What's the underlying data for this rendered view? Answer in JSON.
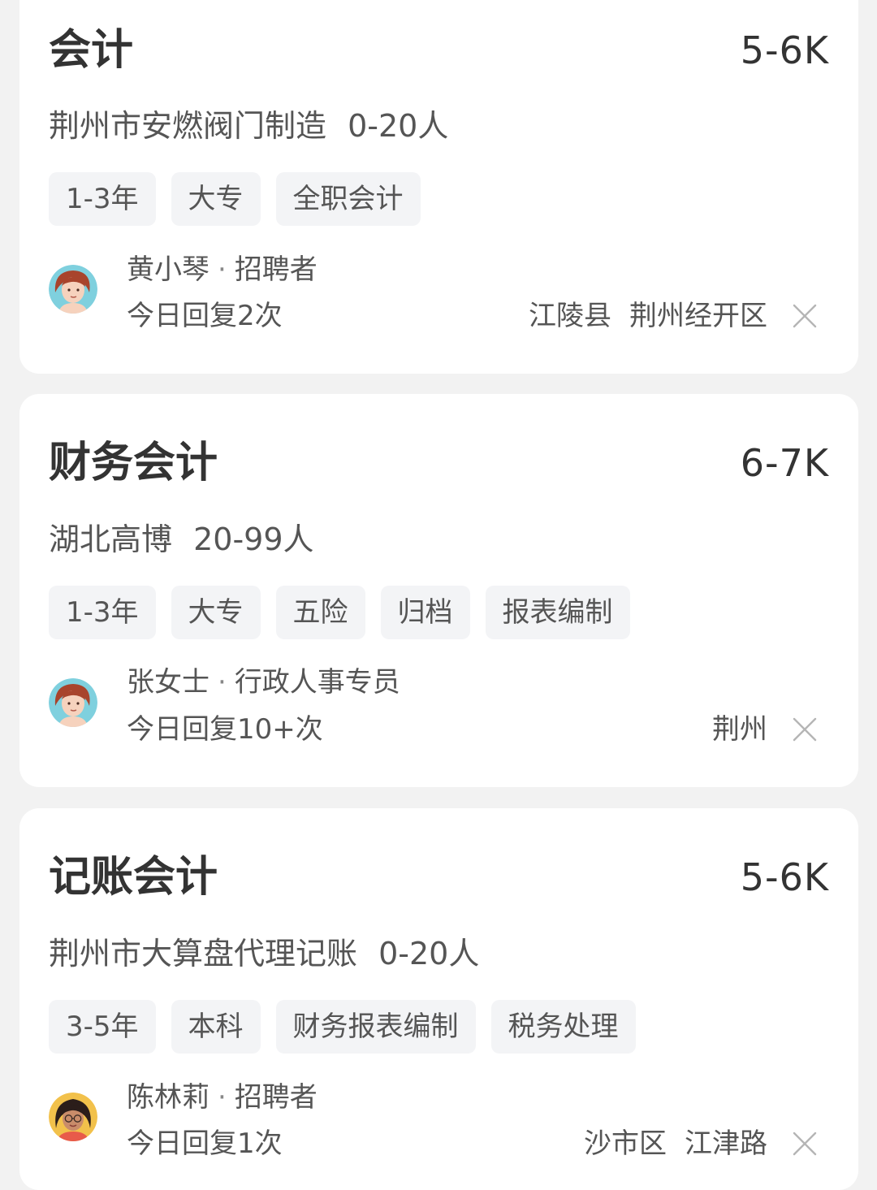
{
  "jobs": [
    {
      "title": "会计",
      "salary": "5-6K",
      "company": "荆州市安燃阀门制造",
      "size": "0-20人",
      "tags": [
        "1-3年",
        "大专",
        "全职会计"
      ],
      "recruiter_name": "黄小琴",
      "recruiter_sep": "·",
      "recruiter_role": "招聘者",
      "reply": "今日回复2次",
      "location": [
        "江陵县",
        "荆州经开区"
      ]
    },
    {
      "title": "财务会计",
      "salary": "6-7K",
      "company": "湖北高博",
      "size": "20-99人",
      "tags": [
        "1-3年",
        "大专",
        "五险",
        "归档",
        "报表编制"
      ],
      "recruiter_name": "张女士",
      "recruiter_sep": "·",
      "recruiter_role": "行政人事专员",
      "reply": "今日回复10+次",
      "location": [
        "荆州"
      ]
    },
    {
      "title": "记账会计",
      "salary": "5-6K",
      "company": "荆州市大算盘代理记账",
      "size": "0-20人",
      "tags": [
        "3-5年",
        "本科",
        "财务报表编制",
        "税务处理"
      ],
      "recruiter_name": "陈林莉",
      "recruiter_sep": "·",
      "recruiter_role": "招聘者",
      "reply": "今日回复1次",
      "location": [
        "沙市区",
        "江津路"
      ]
    }
  ],
  "icons": {
    "dismiss": "close-icon",
    "avatar": "avatar"
  },
  "colors": {
    "background": "#f2f2f2",
    "card": "#ffffff",
    "tag_background": "#f3f4f6",
    "text_primary": "#333333",
    "text_secondary": "#555555"
  }
}
